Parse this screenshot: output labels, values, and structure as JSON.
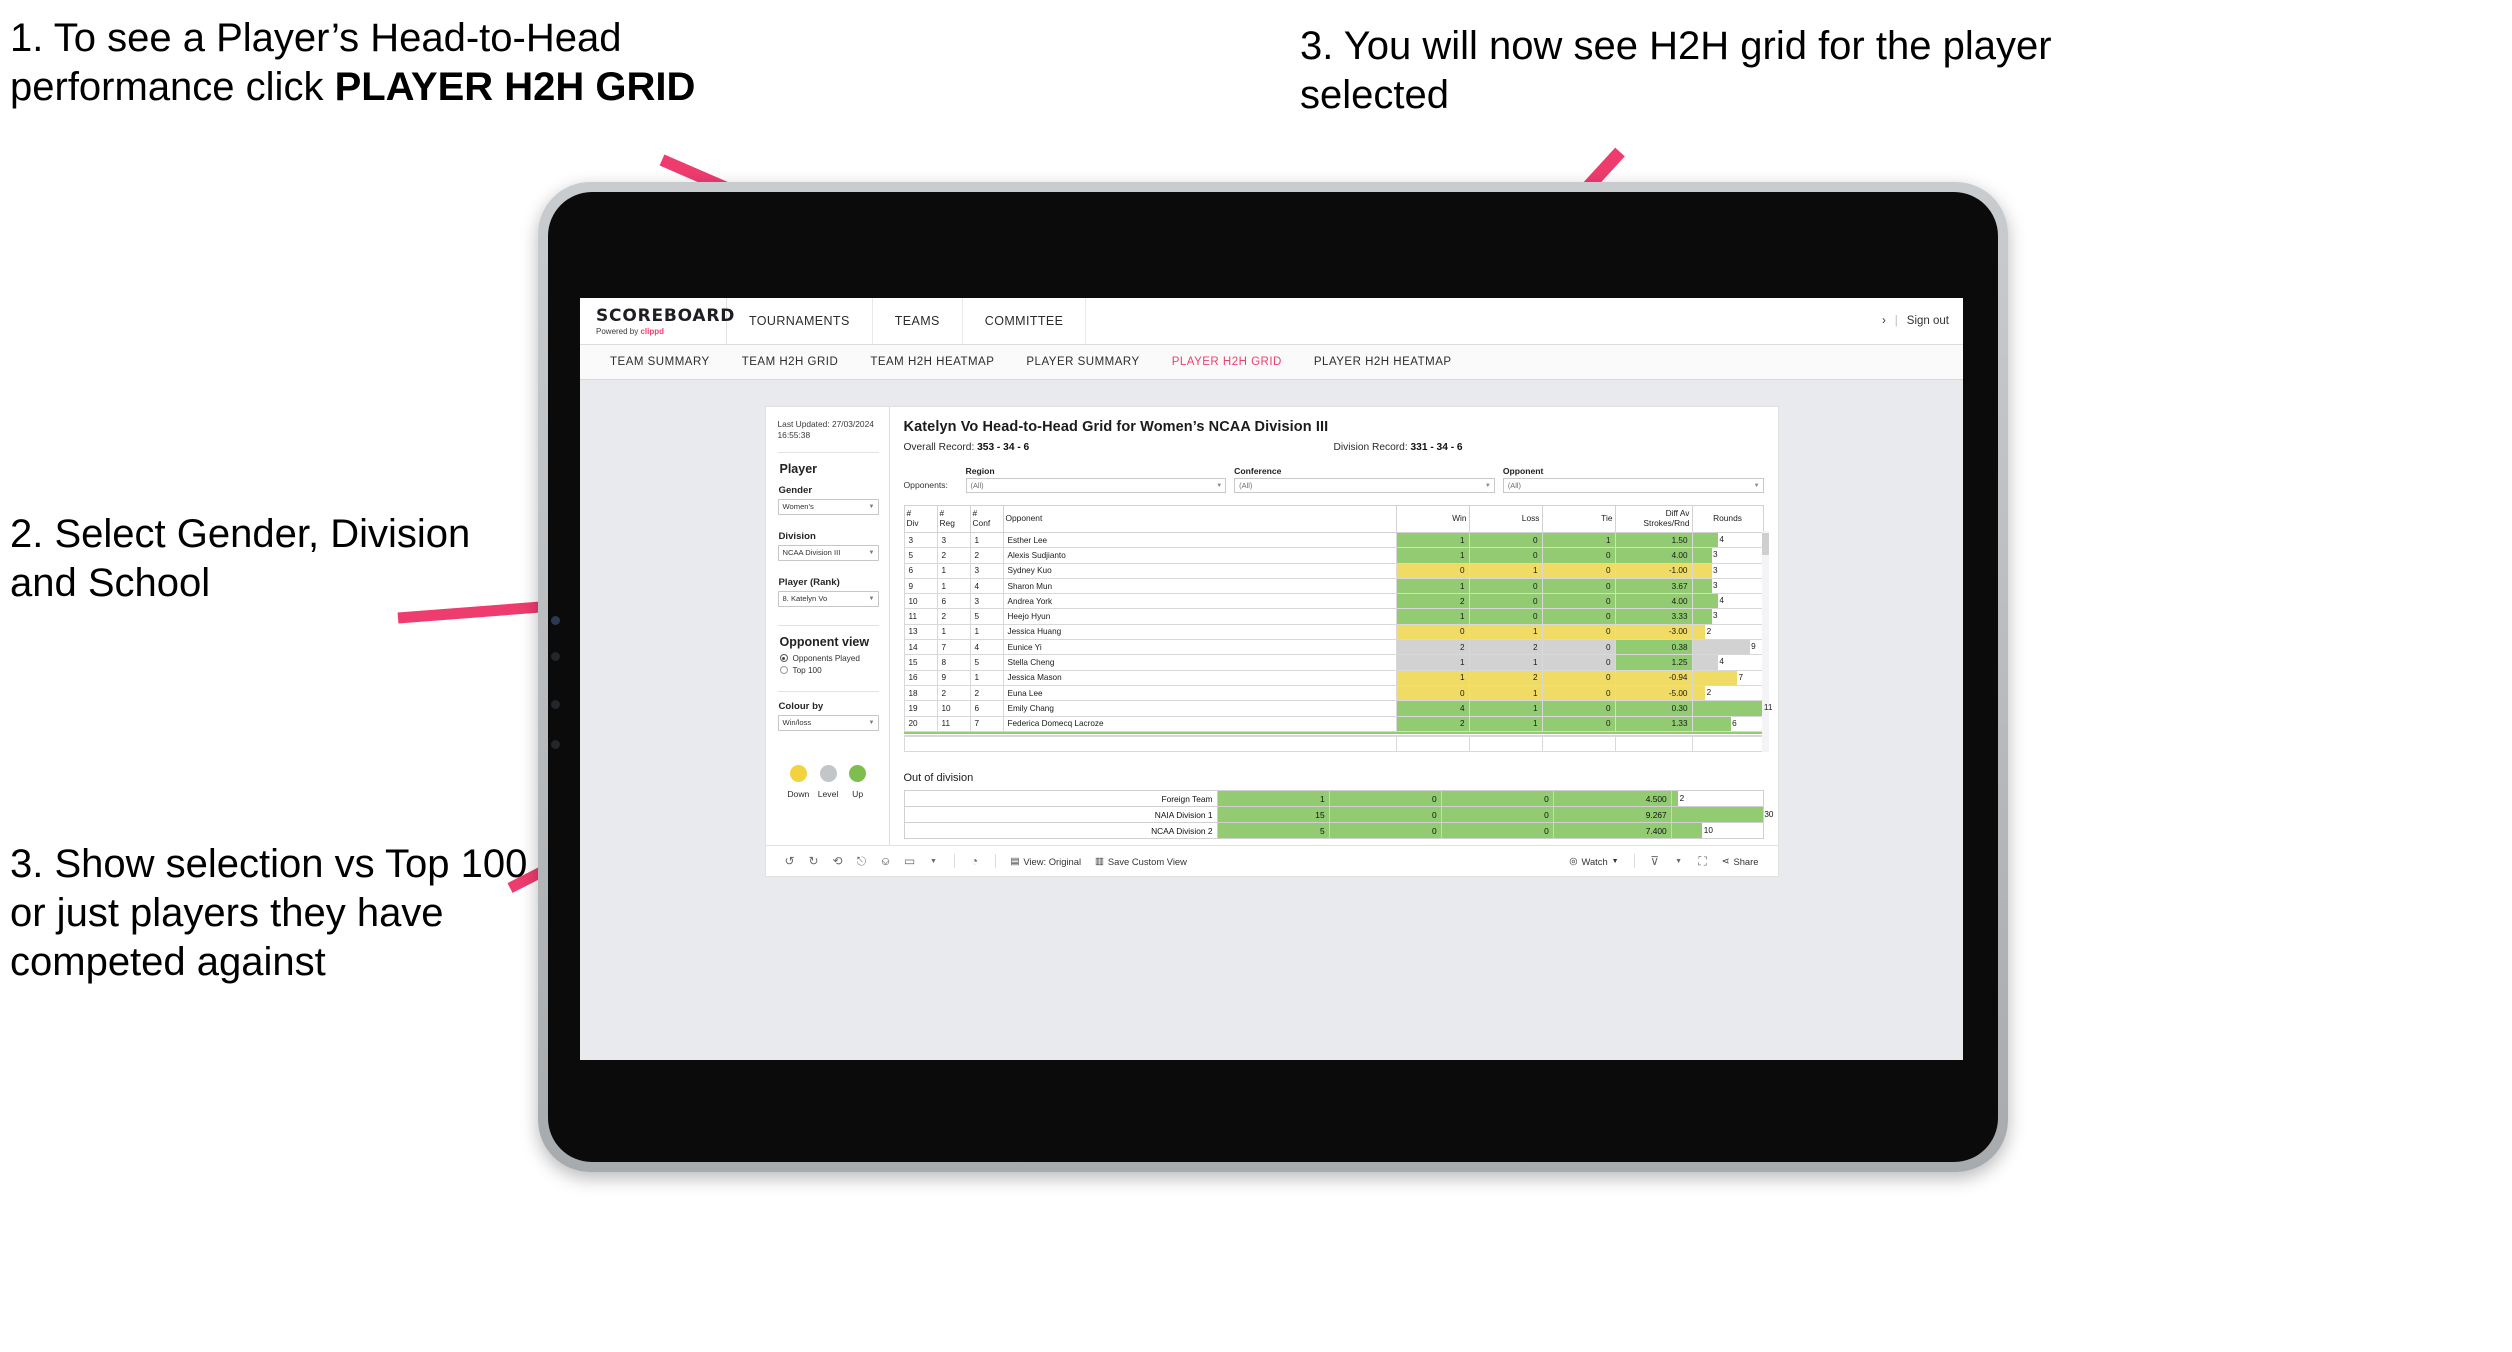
{
  "annotations": [
    {
      "id": "anno1",
      "text_lead": "1. To see a Player’s Head-to-Head performance click ",
      "text_bold": "PLAYER H2H GRID"
    },
    {
      "id": "anno2",
      "text": "2. Select Gender, Division and School"
    },
    {
      "id": "anno3",
      "text": "3. Show selection vs Top 100 or just players they have competed against"
    },
    {
      "id": "anno4",
      "text": "3. You will now see H2H grid for the player selected"
    }
  ],
  "accent_pink": "#ef3e6d",
  "app": {
    "brand_name": "SCOREBOARD",
    "brand_sub_prefix": "Powered by ",
    "brand_sub_accent": "clippd",
    "top_nav": [
      "TOURNAMENTS",
      "TEAMS",
      "COMMITTEE"
    ],
    "account_chevron": "›",
    "separator": "|",
    "sign_out": "Sign out",
    "tabs": [
      {
        "label": "TEAM SUMMARY",
        "active": false
      },
      {
        "label": "TEAM H2H GRID",
        "active": false
      },
      {
        "label": "TEAM H2H HEATMAP",
        "active": false
      },
      {
        "label": "PLAYER SUMMARY",
        "active": false
      },
      {
        "label": "PLAYER H2H GRID",
        "active": true
      },
      {
        "label": "PLAYER H2H HEATMAP",
        "active": false
      }
    ]
  },
  "sidebar": {
    "last_updated_line1": "Last Updated: 27/03/2024",
    "last_updated_line2": "16:55:38",
    "player_section_title": "Player",
    "gender_label": "Gender",
    "gender_value": "Women's",
    "division_label": "Division",
    "division_value": "NCAA Division III",
    "player_rank_label": "Player (Rank)",
    "player_rank_value": "8. Katelyn Vo",
    "opponent_view_title": "Opponent view",
    "opponent_view_options": [
      {
        "label": "Opponents Played",
        "selected": true
      },
      {
        "label": "Top 100",
        "selected": false
      }
    ],
    "colour_by_label": "Colour by",
    "colour_by_value": "Win/loss",
    "legend": [
      {
        "label": "Down",
        "color": "#f2d23f"
      },
      {
        "label": "Level",
        "color": "#c3c6c8"
      },
      {
        "label": "Up",
        "color": "#7ebe4f"
      }
    ]
  },
  "viz": {
    "title": "Katelyn Vo Head-to-Head Grid for Women’s NCAA Division III",
    "overall_record_label": "Overall Record: ",
    "overall_record_value": "353 -  34 - 6",
    "division_record_label": "Division Record: ",
    "division_record_value": "331 -  34 - 6",
    "opponents_label": "Opponents:",
    "filters": [
      {
        "label": "Region",
        "value": "(All)"
      },
      {
        "label": "Conference",
        "value": "(All)"
      },
      {
        "label": "Opponent",
        "value": "(All)"
      }
    ],
    "out_of_division_title": "Out of division"
  },
  "chart_data": {
    "type": "table",
    "title": "Katelyn Vo Head-to-Head Grid for Women’s NCAA Division III",
    "columns": [
      "# Div",
      "# Reg",
      "# Conf",
      "Opponent",
      "Win",
      "Loss",
      "Tie",
      "Diff Av Strokes/Rnd",
      "Rounds"
    ],
    "column_headers_multiline": [
      {
        "l1": "#",
        "l2": "Div"
      },
      {
        "l1": "#",
        "l2": "Reg"
      },
      {
        "l1": "#",
        "l2": "Conf"
      },
      {
        "l1": "Opponent",
        "l2": ""
      },
      {
        "l1": "Win",
        "l2": ""
      },
      {
        "l1": "Loss",
        "l2": ""
      },
      {
        "l1": "Tie",
        "l2": ""
      },
      {
        "l1": "Diff Av",
        "l2": "Strokes/Rnd"
      },
      {
        "l1": "Rounds",
        "l2": ""
      }
    ],
    "rounds_max": 11,
    "rows": [
      {
        "div": "3",
        "reg": "3",
        "conf": "1",
        "opponent": "Esther Lee",
        "win": "1",
        "loss": "0",
        "tie": "1",
        "diff": "1.50",
        "rounds": "4",
        "color": "g"
      },
      {
        "div": "5",
        "reg": "2",
        "conf": "2",
        "opponent": "Alexis Sudjianto",
        "win": "1",
        "loss": "0",
        "tie": "0",
        "diff": "4.00",
        "rounds": "3",
        "color": "g"
      },
      {
        "div": "6",
        "reg": "1",
        "conf": "3",
        "opponent": "Sydney Kuo",
        "win": "0",
        "loss": "1",
        "tie": "0",
        "diff": "-1.00",
        "rounds": "3",
        "color": "y"
      },
      {
        "div": "9",
        "reg": "1",
        "conf": "4",
        "opponent": "Sharon Mun",
        "win": "1",
        "loss": "0",
        "tie": "0",
        "diff": "3.67",
        "rounds": "3",
        "color": "g"
      },
      {
        "div": "10",
        "reg": "6",
        "conf": "3",
        "opponent": "Andrea York",
        "win": "2",
        "loss": "0",
        "tie": "0",
        "diff": "4.00",
        "rounds": "4",
        "color": "g"
      },
      {
        "div": "11",
        "reg": "2",
        "conf": "5",
        "opponent": "Heejo Hyun",
        "win": "1",
        "loss": "0",
        "tie": "0",
        "diff": "3.33",
        "rounds": "3",
        "color": "g"
      },
      {
        "div": "13",
        "reg": "1",
        "conf": "1",
        "opponent": "Jessica Huang",
        "win": "0",
        "loss": "1",
        "tie": "0",
        "diff": "-3.00",
        "rounds": "2",
        "color": "y"
      },
      {
        "div": "14",
        "reg": "7",
        "conf": "4",
        "opponent": "Eunice Yi",
        "win": "2",
        "loss": "2",
        "tie": "0",
        "diff": "0.38",
        "rounds": "9",
        "color": "n",
        "diff_color": "g"
      },
      {
        "div": "15",
        "reg": "8",
        "conf": "5",
        "opponent": "Stella Cheng",
        "win": "1",
        "loss": "1",
        "tie": "0",
        "diff": "1.25",
        "rounds": "4",
        "color": "n",
        "diff_color": "g"
      },
      {
        "div": "16",
        "reg": "9",
        "conf": "1",
        "opponent": "Jessica Mason",
        "win": "1",
        "loss": "2",
        "tie": "0",
        "diff": "-0.94",
        "rounds": "7",
        "color": "y"
      },
      {
        "div": "18",
        "reg": "2",
        "conf": "2",
        "opponent": "Euna Lee",
        "win": "0",
        "loss": "1",
        "tie": "0",
        "diff": "-5.00",
        "rounds": "2",
        "color": "y"
      },
      {
        "div": "19",
        "reg": "10",
        "conf": "6",
        "opponent": "Emily Chang",
        "win": "4",
        "loss": "1",
        "tie": "0",
        "diff": "0.30",
        "rounds": "11",
        "color": "g"
      },
      {
        "div": "20",
        "reg": "11",
        "conf": "7",
        "opponent": "Federica Domecq Lacroze",
        "win": "2",
        "loss": "1",
        "tie": "0",
        "diff": "1.33",
        "rounds": "6",
        "color": "g"
      }
    ],
    "out_of_division": {
      "rounds_max": 30,
      "rows": [
        {
          "name": "Foreign Team",
          "win": "1",
          "loss": "0",
          "tie": "0",
          "diff": "4.500",
          "rounds": "2",
          "color": "g"
        },
        {
          "name": "NAIA Division 1",
          "win": "15",
          "loss": "0",
          "tie": "0",
          "diff": "9.267",
          "rounds": "30",
          "color": "g"
        },
        {
          "name": "NCAA Division 2",
          "win": "5",
          "loss": "0",
          "tie": "0",
          "diff": "7.400",
          "rounds": "10",
          "color": "g"
        }
      ]
    }
  },
  "toolbar": {
    "icons": [
      "undo-icon",
      "redo-icon",
      "revert-icon",
      "refresh-icon",
      "pause-icon",
      "zoom-icon",
      "caret-icon"
    ],
    "clock_icon": "clock-icon",
    "view_label": "View: Original",
    "save_label": "Save Custom View",
    "watch_label": "Watch",
    "share_label": "Share"
  }
}
